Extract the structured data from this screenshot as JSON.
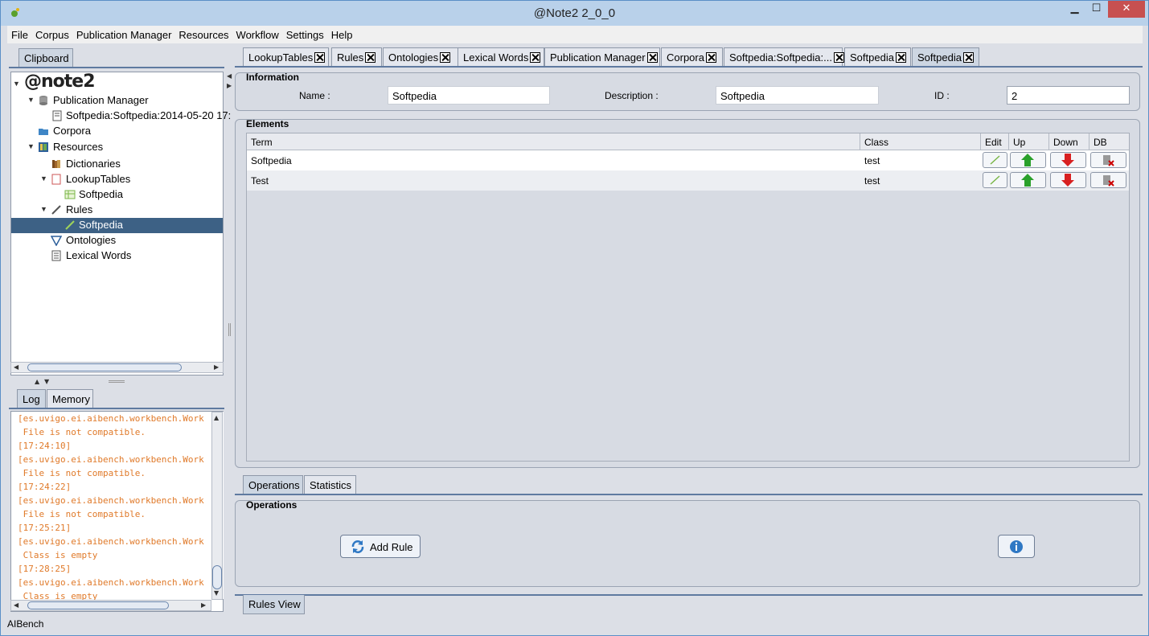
{
  "window": {
    "title": "@Note2 2_0_0",
    "minimize_label": "▁",
    "maximize_label": "☐",
    "close_label": "✕"
  },
  "menu": [
    "File",
    "Corpus",
    "Publication Manager",
    "Resources",
    "Workflow",
    "Settings",
    "Help"
  ],
  "left_tabs": {
    "clipboard": "Clipboard",
    "log": "Log",
    "memory": "Memory"
  },
  "tree": {
    "logo": "@note2",
    "items": [
      {
        "label": "Publication Manager"
      },
      {
        "label": "Softpedia:Softpedia:2014-05-20 17:"
      },
      {
        "label": "Corpora"
      },
      {
        "label": "Resources"
      },
      {
        "label": "Dictionaries"
      },
      {
        "label": "LookupTables"
      },
      {
        "label": "Softpedia"
      },
      {
        "label": "Rules"
      },
      {
        "label": "Softpedia"
      },
      {
        "label": "Ontologies"
      },
      {
        "label": "Lexical Words"
      }
    ]
  },
  "log_lines": [
    "[es.uvigo.ei.aibench.workbench.Work",
    " File is not compatible.",
    "[17:24:10]",
    "[es.uvigo.ei.aibench.workbench.Work",
    " File is not compatible.",
    "[17:24:22]",
    "[es.uvigo.ei.aibench.workbench.Work",
    " File is not compatible.",
    "[17:25:21]",
    "[es.uvigo.ei.aibench.workbench.Work",
    " Class is empty",
    "[17:28:25]",
    "[es.uvigo.ei.aibench.workbench.Work",
    " Class is empty"
  ],
  "doc_tabs": [
    "LookupTables",
    "Rules",
    "Ontologies",
    "Lexical Words",
    "Publication Manager",
    "Corpora",
    "Softpedia:Softpedia:...",
    "Softpedia",
    "Softpedia"
  ],
  "information": {
    "title": "Information",
    "name_label": "Name :",
    "name_value": "Softpedia",
    "description_label": "Description :",
    "description_value": "Softpedia",
    "id_label": "ID :",
    "id_value": "2"
  },
  "elements": {
    "title": "Elements",
    "columns": [
      "Term",
      "Class",
      "Edit",
      "Up",
      "Down",
      "DB"
    ],
    "rows": [
      {
        "term": "Softpedia",
        "class": "test"
      },
      {
        "term": "Test",
        "class": "test"
      }
    ]
  },
  "bottom_tabs": {
    "operations": "Operations",
    "statistics": "Statistics"
  },
  "operations": {
    "title": "Operations",
    "add_rule": "Add Rule"
  },
  "view_tab": "Rules View",
  "status": "AIBench",
  "colors": {
    "selection": "#3d6185",
    "log_text": "#e07a2a",
    "titlebar": "#b9d1ea",
    "close": "#c75050"
  }
}
